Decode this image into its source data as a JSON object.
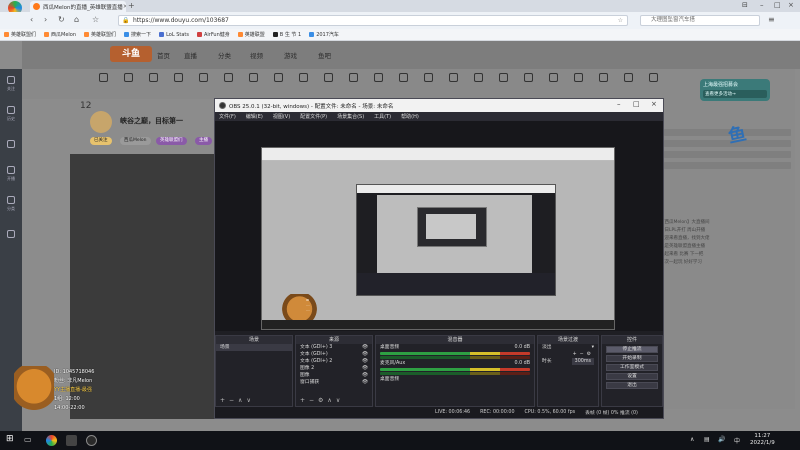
{
  "browser": {
    "tab_title": "西瓜Melon的直播_英雄联盟直播",
    "logo_label": "启用新版",
    "url": "https://www.douyu.com/103687",
    "search_placeholder": "大理图坠窗汽车搭",
    "bookmarks": [
      "英雄联盟们",
      "西瓜Melon",
      "英雄联盟们",
      "搜索一下",
      "LoL Stats",
      "AirFun健身",
      "英雄联盟",
      "B 生 节 1",
      "2017汽车"
    ]
  },
  "site": {
    "logo": "斗鱼",
    "nav": [
      "首页",
      "直播",
      "分类",
      "视频",
      "游戏",
      "鱼吧"
    ],
    "categories": [
      "",
      "",
      "",
      "",
      "",
      "",
      "",
      "",
      "",
      "",
      "",
      "",
      "",
      "",
      "",
      "",
      "",
      "",
      "",
      "",
      "",
      "",
      "",
      "",
      ""
    ],
    "streamer": {
      "level": "12",
      "title": "峡谷之巅，目标第一",
      "tags": [
        "已关注",
        "西瓜Melon",
        "英雄联盟们",
        "主播"
      ]
    },
    "left_items": [
      "关注",
      "历史",
      "",
      "开播",
      "分类",
      "",
      "回放"
    ],
    "promo": {
      "title": "上海最强招募会",
      "button": "查看更多活动→"
    },
    "right_big_text": "鱼",
    "desc_lines": [
      "【西瓜Melon】大直播间",
      "今日LPL开打 周山开播",
      "欢迎来看直播，找到大佬",
      "我是英雄联盟直播主播",
      "一起来看 比赛 下一把",
      "下次一起玩 好好学习"
    ]
  },
  "overlay_info": {
    "lines": [
      "ID: 1045718046",
      "粉丝: 非凡Melon",
      "YY主播直播-最强",
      "1组: 12:00",
      "14:00-22:00"
    ]
  },
  "obs": {
    "title": "OBS 25.0.1 (32-bit, windows) - 配置文件: 未命名 - 场景: 未命名",
    "menu": [
      "文件(F)",
      "编辑(E)",
      "视图(V)",
      "配置文件(P)",
      "场景集合(S)",
      "工具(T)",
      "帮助(H)"
    ],
    "docks": {
      "scenes": {
        "title": "场景",
        "items": [
          "场景"
        ]
      },
      "sources": {
        "title": "来源",
        "items": [
          "文本 (GDI+) 3",
          "文本 (GDI+)",
          "文本 (GDI+) 2",
          "图像 2",
          "图像",
          "窗口捕获"
        ]
      },
      "mixer": {
        "title": "混音器",
        "items": [
          {
            "name": "桌面音频",
            "db": "0.0 dB"
          },
          {
            "name": "麦克风/Aux",
            "db": "0.0 dB"
          },
          {
            "name": "桌面音频",
            "db": ""
          }
        ]
      },
      "transitions": {
        "title": "场景过渡",
        "type": "淡出",
        "duration_label": "时长",
        "duration": "300ms"
      },
      "controls": {
        "title": "控件",
        "buttons": [
          "停止推流",
          "开始录制",
          "工作室模式",
          "设置",
          "退出"
        ]
      }
    },
    "status": {
      "live": "LIVE: 00:06:46",
      "rec": "REC: 00:00:00",
      "cpu": "CPU: 0.5%, 60.00 fps",
      "dropped": "丢帧 (0 帧) 0% 推流 (0)"
    }
  },
  "taskbar": {
    "time": "11:27",
    "date": "2022/1/9",
    "lang": "中"
  }
}
